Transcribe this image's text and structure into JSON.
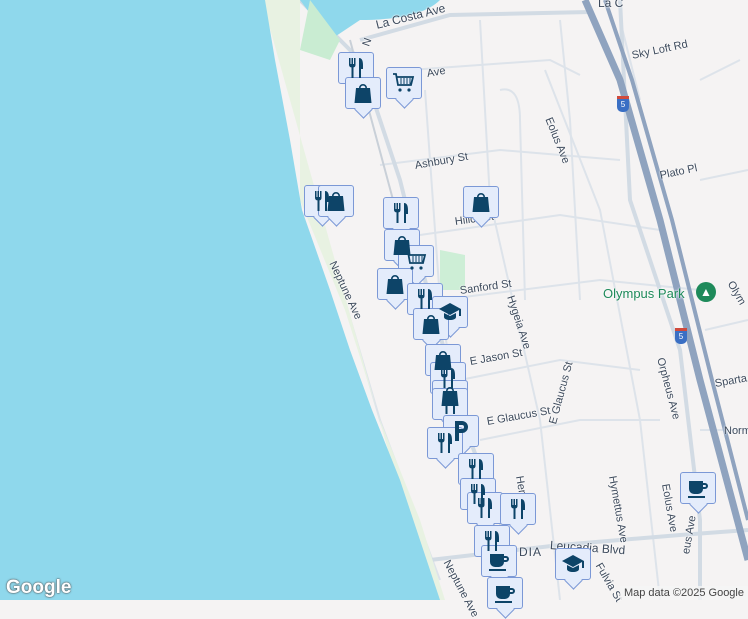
{
  "map": {
    "streets": [
      "La Costa Ave",
      "La C",
      "Sky Loft Rd",
      "Ave",
      "Eolus Ave",
      "Ashbury St",
      "Plato Pl",
      "Hillcrest",
      "Neptune Ave",
      "Sanford St",
      "Hygeia Ave",
      "Olympus Park",
      "E Jason St",
      "E Glaucus St",
      "E Glaucus St",
      "Orpheus Ave",
      "Sparta D",
      "Norm",
      "Hymettus Ave",
      "Eolus Ave",
      "Herm",
      "Leucadia Blvd",
      "DIA",
      "Fulvia St",
      "Neptune Ave",
      "eus Ave",
      "Olym",
      "N"
    ],
    "highway_shield": "5",
    "colors": {
      "water": "#8fd8ec",
      "land": "#f5f3f3",
      "road": "#d7dee6",
      "highway": "#8fa3bf",
      "marker_bg": "#e4ecfb",
      "marker_icon": "#0d4468",
      "park": "#1e8a5a"
    }
  },
  "markers": [
    {
      "type": "restaurant"
    },
    {
      "type": "shopping"
    },
    {
      "type": "grocery"
    },
    {
      "type": "restaurant"
    },
    {
      "type": "shopping"
    },
    {
      "type": "shopping"
    },
    {
      "type": "restaurant"
    },
    {
      "type": "shopping"
    },
    {
      "type": "grocery"
    },
    {
      "type": "shopping"
    },
    {
      "type": "restaurant"
    },
    {
      "type": "school"
    },
    {
      "type": "shopping"
    },
    {
      "type": "shopping"
    },
    {
      "type": "restaurant"
    },
    {
      "type": "shopping"
    },
    {
      "type": "restaurant"
    },
    {
      "type": "parking"
    },
    {
      "type": "restaurant"
    },
    {
      "type": "restaurant"
    },
    {
      "type": "restaurant"
    },
    {
      "type": "restaurant"
    },
    {
      "type": "restaurant"
    },
    {
      "type": "restaurant"
    },
    {
      "type": "cafe"
    },
    {
      "type": "cafe"
    },
    {
      "type": "school"
    },
    {
      "type": "cafe"
    }
  ],
  "branding": {
    "logo": "Google",
    "credit": "Map data ©2025 Google"
  }
}
